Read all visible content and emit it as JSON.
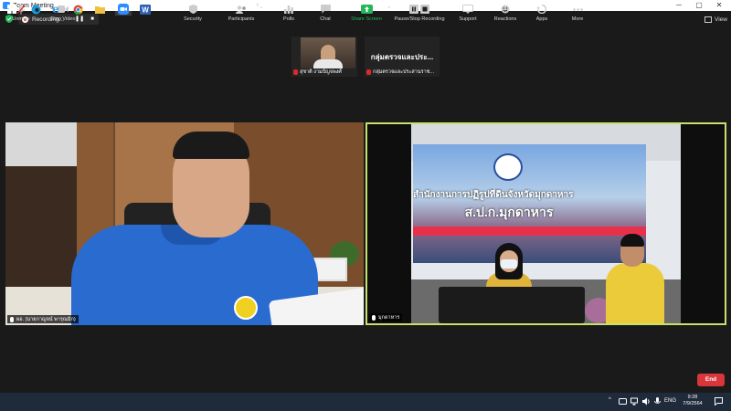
{
  "window": {
    "title": "Zoom Meeting",
    "controls": {
      "minimize": "─",
      "maximize": "▢",
      "close": "✕"
    }
  },
  "recording": {
    "label": "Recording...",
    "pause_symbol": "❚❚",
    "stop_symbol": "■"
  },
  "view_button": {
    "label": "View"
  },
  "thumbnails": [
    {
      "name": "สุชาติ งามปัญจพงศ์"
    },
    {
      "display_text": "กลุ่มตรวจและประ...",
      "name": "กลุ่มตรวจและประสานราช..."
    }
  ],
  "tiles": [
    {
      "name": "ผอ. (นายกาญจน์ พารุณมิก)"
    },
    {
      "name": "มุกดาหาร"
    }
  ],
  "scene_text": {
    "banner_line1": "สำนักงานการปฏิรูปที่ดินจังหวัดมุกดาหาร",
    "banner_line2": "ส.ป.ก.มุกดาหาร"
  },
  "toolbar": {
    "unmute": "Unmute",
    "stop_video": "Stop Video",
    "security": "Security",
    "participants": "Participants",
    "participants_count": "4",
    "polls": "Polls",
    "chat": "Chat",
    "share_screen": "Share Screen",
    "pause_stop_recording": "Pause/Stop Recording",
    "support": "Support",
    "reactions": "Reactions",
    "apps": "Apps",
    "more": "More",
    "end": "End",
    "caret": "^"
  },
  "taskbar": {
    "language": "ENG",
    "time": "9:28",
    "date": "7/9/2564"
  },
  "colors": {
    "zoom_blue": "#2d8cff",
    "share_green": "#25b65a",
    "end_red": "#d8363a",
    "active_speaker_border": "#c8e06c",
    "taskbar": "#1f2a3a"
  }
}
